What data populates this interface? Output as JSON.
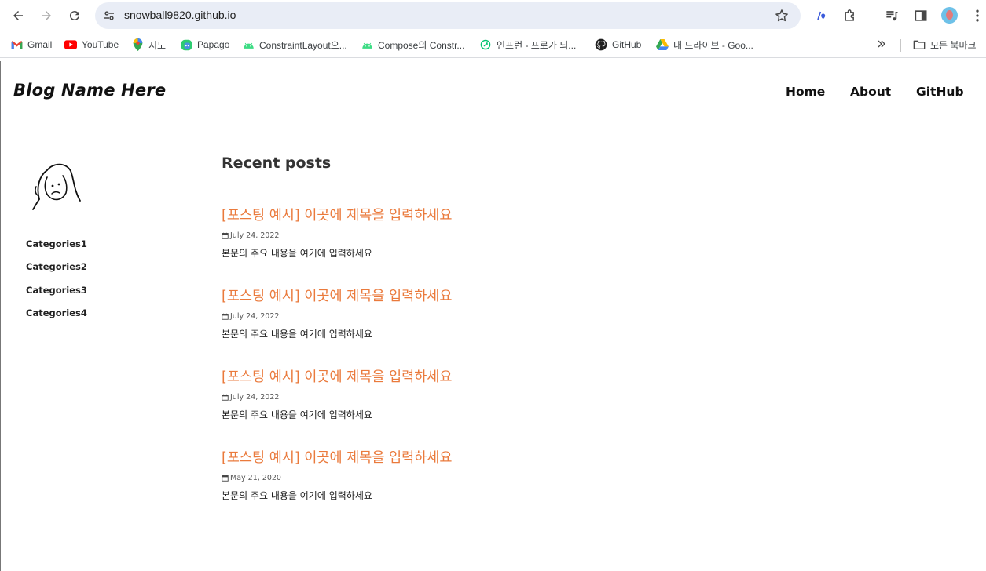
{
  "browser": {
    "url": "snowball9820.github.io",
    "bookmarks": [
      {
        "label": "Gmail",
        "icon": "gmail-icon"
      },
      {
        "label": "YouTube",
        "icon": "youtube-icon"
      },
      {
        "label": "지도",
        "icon": "maps-icon"
      },
      {
        "label": "Papago",
        "icon": "papago-icon"
      },
      {
        "label": "ConstraintLayout으...",
        "icon": "android-icon"
      },
      {
        "label": "Compose의 Constr...",
        "icon": "android-icon"
      },
      {
        "label": "인프런 - 프로가 되...",
        "icon": "inflearn-icon"
      },
      {
        "label": "GitHub",
        "icon": "github-icon"
      },
      {
        "label": "내 드라이브 - Goo...",
        "icon": "google-drive-icon"
      }
    ],
    "all_bookmarks_label": "모든 북마크"
  },
  "site": {
    "title": "Blog Name Here",
    "nav": [
      "Home",
      "About",
      "GitHub"
    ]
  },
  "sidebar": {
    "categories": [
      "Categories1",
      "Categories2",
      "Categories3",
      "Categories4"
    ]
  },
  "main": {
    "heading": "Recent posts",
    "posts": [
      {
        "title": "[포스팅 예시] 이곳에 제목을 입력하세요",
        "date": "July 24, 2022",
        "excerpt": "본문의 주요 내용을 여기에 입력하세요"
      },
      {
        "title": "[포스팅 예시] 이곳에 제목을 입력하세요",
        "date": "July 24, 2022",
        "excerpt": "본문의 주요 내용을 여기에 입력하세요"
      },
      {
        "title": "[포스팅 예시] 이곳에 제목을 입력하세요",
        "date": "July 24, 2022",
        "excerpt": "본문의 주요 내용을 여기에 입력하세요"
      },
      {
        "title": "[포스팅 예시] 이곳에 제목을 입력하세요",
        "date": "May 21, 2020",
        "excerpt": "본문의 주요 내용을 여기에 입력하세요"
      }
    ]
  },
  "colors": {
    "post_title": "#ea7a3c",
    "omnibox": "#e9edf6"
  }
}
